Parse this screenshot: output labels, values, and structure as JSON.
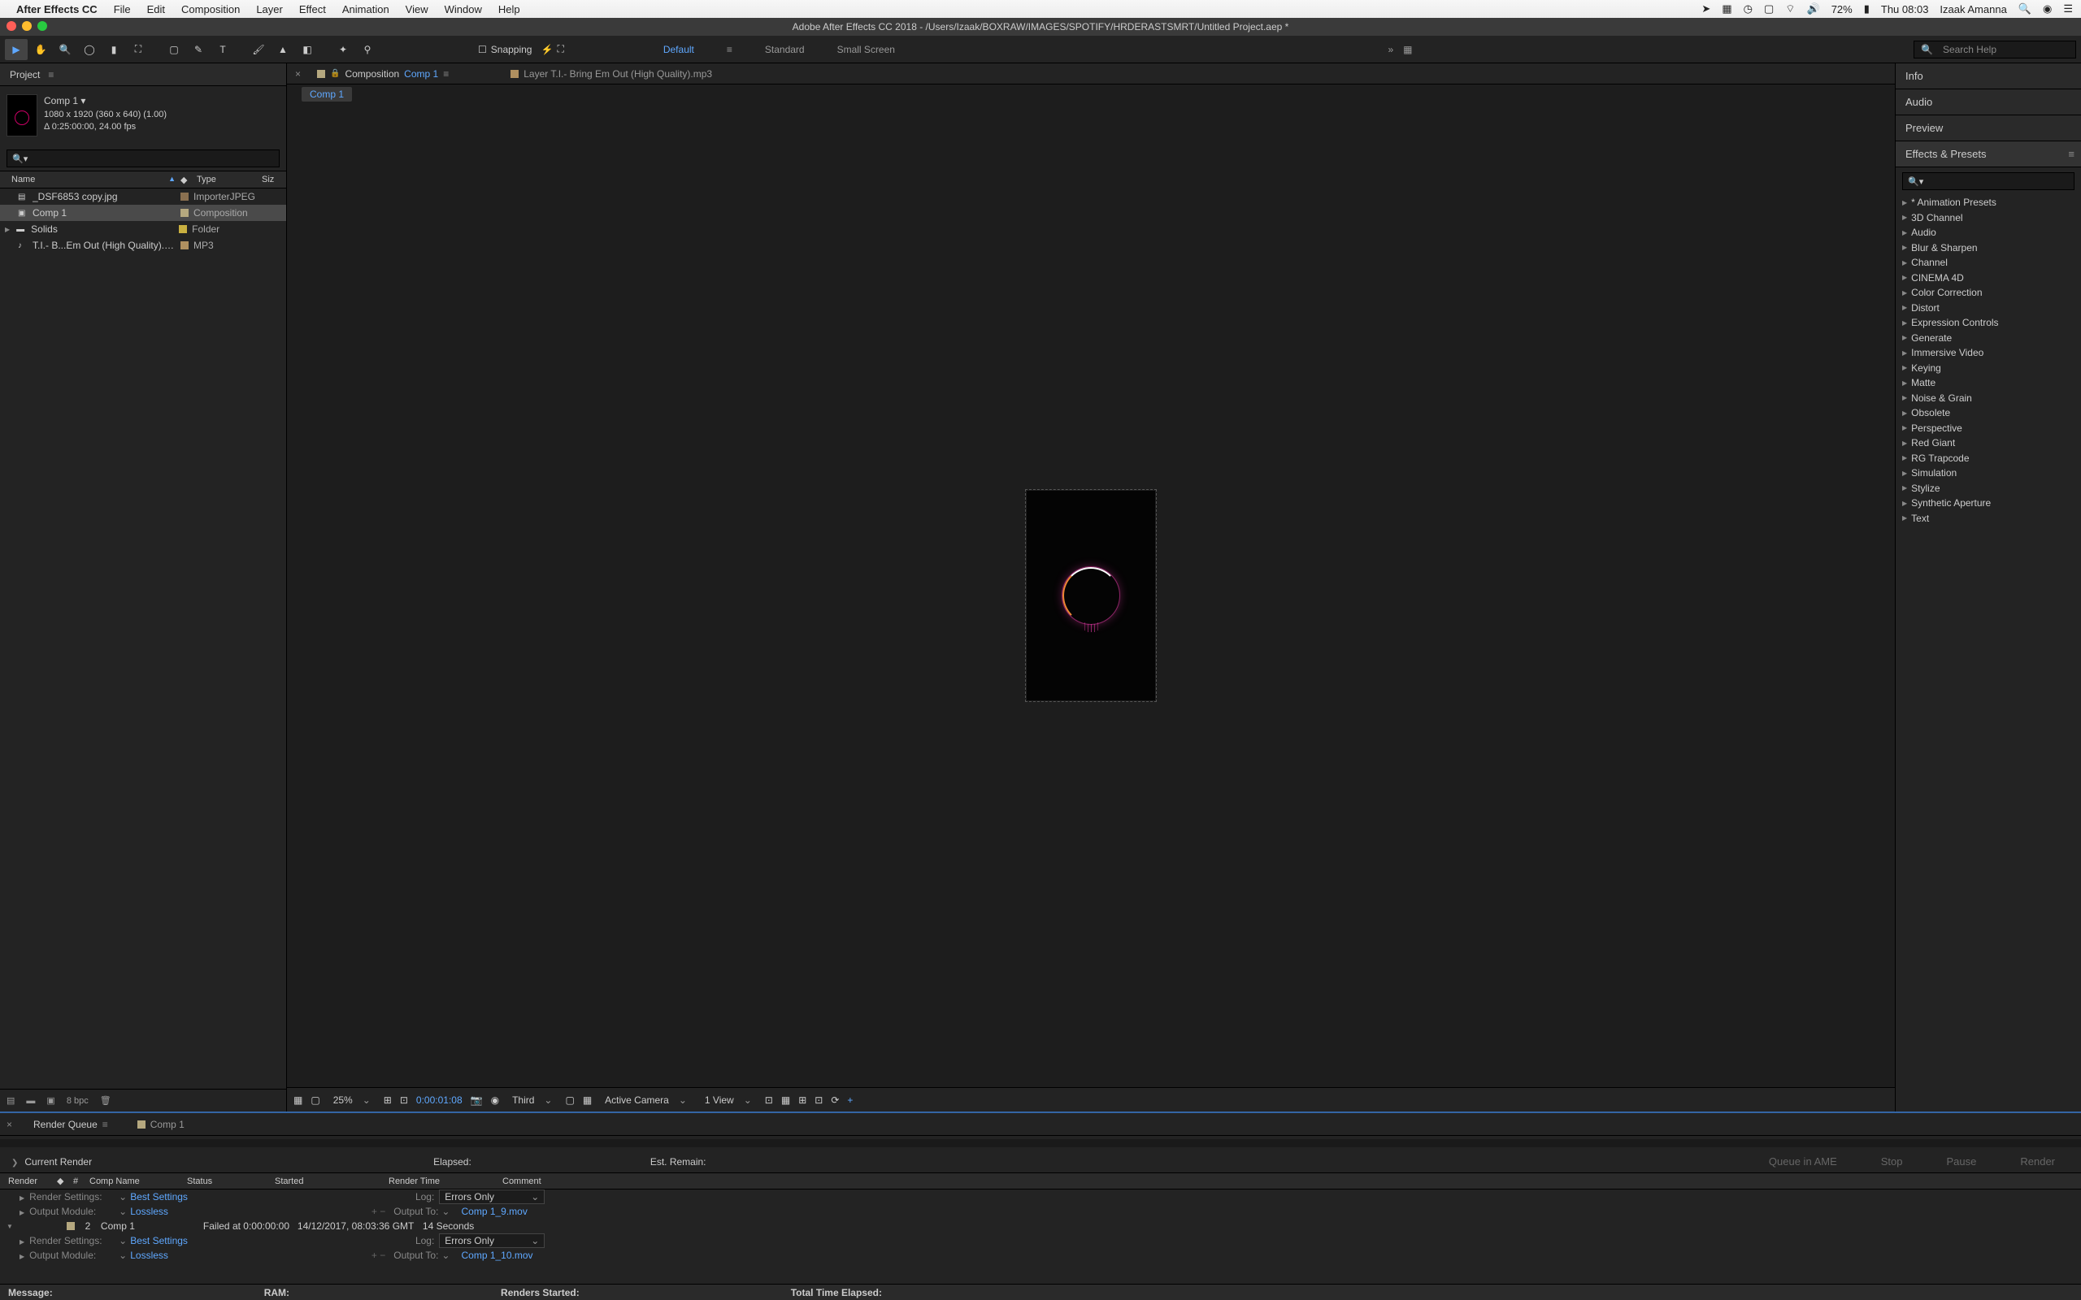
{
  "menubar": {
    "app": "After Effects CC",
    "items": [
      "File",
      "Edit",
      "Composition",
      "Layer",
      "Effect",
      "Animation",
      "View",
      "Window",
      "Help"
    ],
    "battery": "72%",
    "datetime": "Thu 08:03",
    "user": "Izaak Amanna"
  },
  "titlebar": "Adobe After Effects CC 2018 - /Users/Izaak/BOXRAW/IMAGES/SPOTIFY/HRDERASTSMRT/Untitled Project.aep *",
  "toolbar": {
    "snapping": "Snapping",
    "workspaces": [
      "Default",
      "Standard",
      "Small Screen"
    ],
    "search_placeholder": "Search Help"
  },
  "project": {
    "tab": "Project",
    "comp_name": "Comp 1 ▾",
    "comp_dims": "1080 x 1920  (360 x 640) (1.00)",
    "comp_dur": "Δ 0:25:00:00, 24.00 fps",
    "cols": {
      "name": "Name",
      "type": "Type",
      "size": "Siz"
    },
    "items": [
      {
        "name": "_DSF6853 copy.jpg",
        "type": "ImporterJPEG",
        "swatch": "sw-brown",
        "selected": false,
        "children": false,
        "icon": "▤"
      },
      {
        "name": "Comp 1",
        "type": "Composition",
        "swatch": "sw-peach",
        "selected": true,
        "children": false,
        "icon": "▣"
      },
      {
        "name": "Solids",
        "type": "Folder",
        "swatch": "sw-yellow",
        "selected": false,
        "children": true,
        "icon": "▬"
      },
      {
        "name": "T.I.- B...Em Out (High Quality).mp3",
        "type": "MP3",
        "swatch": "sw-tan",
        "selected": false,
        "children": false,
        "icon": "♪"
      }
    ],
    "footer_bpc": "8 bpc"
  },
  "center": {
    "tab1_prefix": "Composition",
    "tab1_name": "Comp 1",
    "tab2": "Layer T.I.- Bring Em Out (High Quality).mp3",
    "breadcrumb": "Comp 1",
    "zoom": "25%",
    "time": "0:00:01:08",
    "resolution": "Third",
    "camera": "Active Camera",
    "views": "1 View"
  },
  "right": {
    "panels": [
      "Info",
      "Audio",
      "Preview"
    ],
    "effects_header": "Effects & Presets",
    "effects": [
      "* Animation Presets",
      "3D Channel",
      "Audio",
      "Blur & Sharpen",
      "Channel",
      "CINEMA 4D",
      "Color Correction",
      "Distort",
      "Expression Controls",
      "Generate",
      "Immersive Video",
      "Keying",
      "Matte",
      "Noise & Grain",
      "Obsolete",
      "Perspective",
      "Red Giant",
      "RG Trapcode",
      "Simulation",
      "Stylize",
      "Synthetic Aperture",
      "Text"
    ]
  },
  "render_queue": {
    "tab": "Render Queue",
    "comp_tab": "Comp 1",
    "current": "Current Render",
    "elapsed": "Elapsed:",
    "remain": "Est. Remain:",
    "buttons": [
      "Queue in AME",
      "Stop",
      "Pause",
      "Render"
    ],
    "cols": {
      "render": "Render",
      "num": "#",
      "comp": "Comp Name",
      "status": "Status",
      "started": "Started",
      "rtime": "Render Time",
      "comment": "Comment"
    },
    "settings_label": "Render Settings:",
    "settings_val": "Best Settings",
    "output_label": "Output Module:",
    "output_val": "Lossless",
    "log_label": "Log:",
    "log_val": "Errors Only",
    "output_to": "Output To:",
    "outfile1": "Comp 1_9.mov",
    "entry2_num": "2",
    "entry2_comp": "Comp 1",
    "entry2_status": "Failed at 0:00:00:00",
    "entry2_started": "14/12/2017, 08:03:36 GMT",
    "entry2_rtime": "14 Seconds",
    "outfile2": "Comp 1_10.mov",
    "footer": {
      "message": "Message:",
      "ram": "RAM:",
      "started": "Renders Started:",
      "total": "Total Time Elapsed:"
    }
  }
}
